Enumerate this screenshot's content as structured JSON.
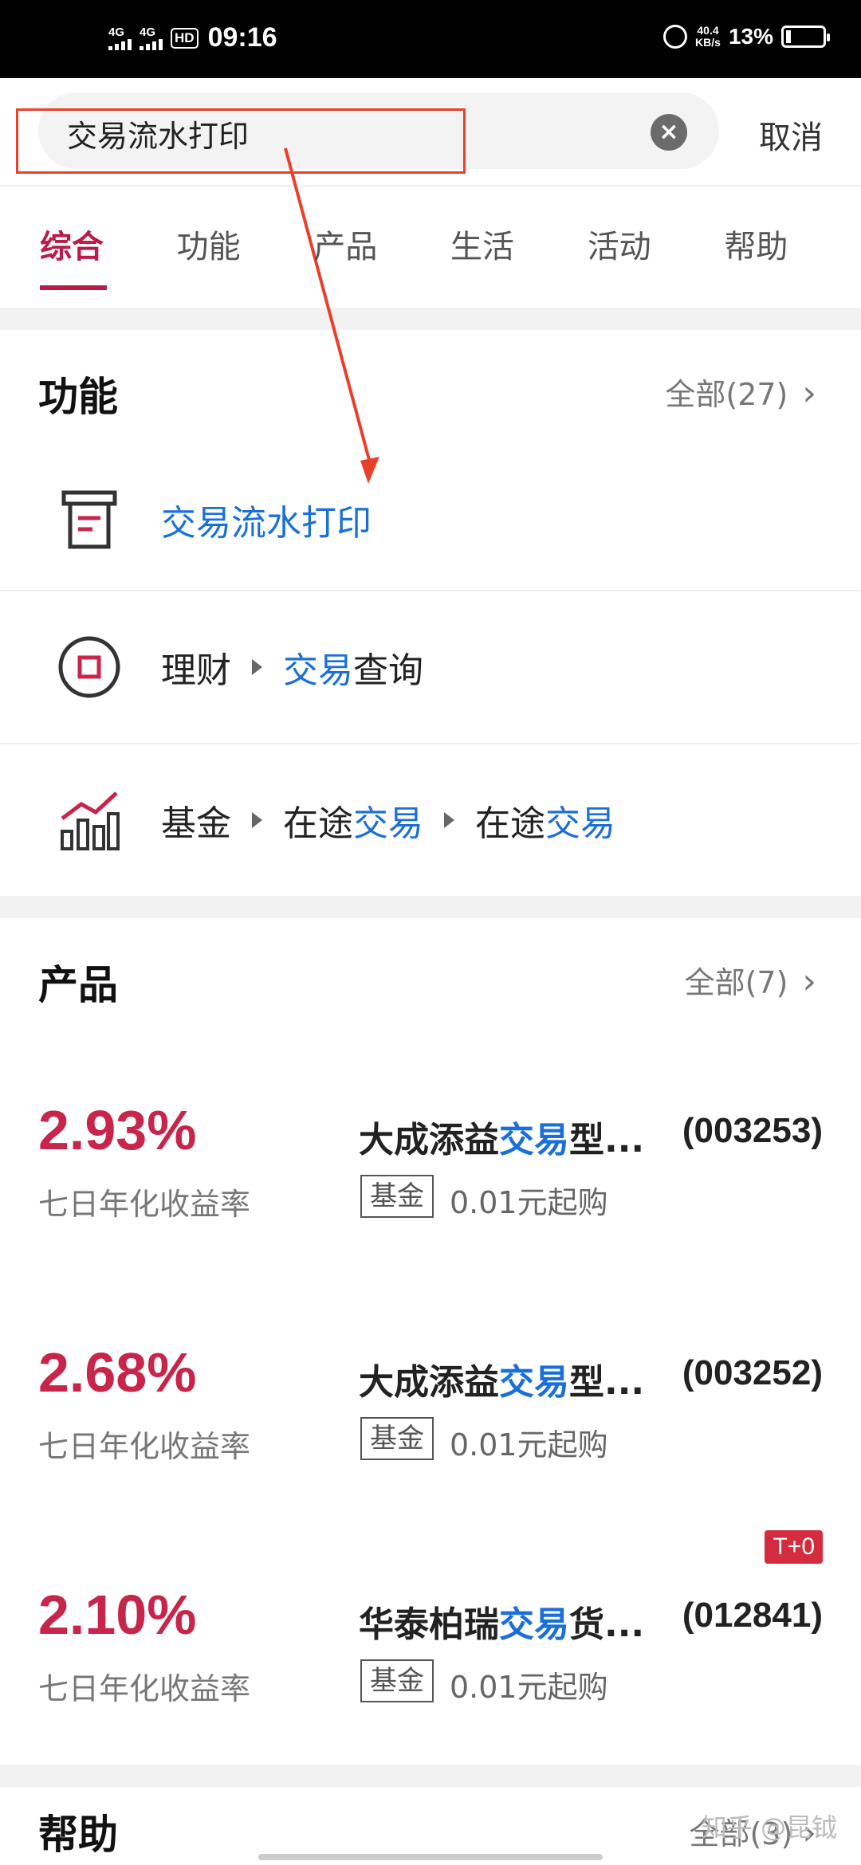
{
  "status": {
    "net1": "4G",
    "net2": "4G",
    "hd": "HD",
    "time": "09:16",
    "speed_top": "40.4",
    "speed_bottom": "KB/s",
    "battery": "13%"
  },
  "search": {
    "query": "交易流水打印",
    "cancel": "取消"
  },
  "tabs": [
    "综合",
    "功能",
    "产品",
    "生活",
    "活动",
    "帮助"
  ],
  "functions": {
    "title": "功能",
    "all": "全部(27)",
    "items": [
      {
        "icon": "printer-icon",
        "text": "交易流水打印"
      },
      {
        "icon": "wealth-icon",
        "path": [
          "理财",
          "交易查询"
        ]
      },
      {
        "icon": "fund-chart-icon",
        "path": [
          "基金",
          "在途交易",
          "在途交易"
        ]
      }
    ]
  },
  "products": {
    "title": "产品",
    "all": "全部(7)",
    "items": [
      {
        "rate": "2.93%",
        "rate_label": "七日年化收益率",
        "name_pre": "大成添益",
        "name_hl": "交易",
        "name_post": "型...",
        "code": "(003253)",
        "tag": "基金",
        "min": "0.01元起购"
      },
      {
        "rate": "2.68%",
        "rate_label": "七日年化收益率",
        "name_pre": "大成添益",
        "name_hl": "交易",
        "name_post": "型...",
        "code": "(003252)",
        "tag": "基金",
        "min": "0.01元起购"
      },
      {
        "rate": "2.10%",
        "rate_label": "七日年化收益率",
        "name_pre": "华泰柏瑞",
        "name_hl": "交易",
        "name_post": "货...",
        "code": "(012841)",
        "tag": "基金",
        "min": "0.01元起购",
        "badge": "T+0"
      }
    ]
  },
  "help": {
    "title": "帮助",
    "all": "全部(3)"
  },
  "watermark": "知乎 @昆钺",
  "colors": {
    "accent": "#b91d47",
    "link": "#1a6fd8",
    "rate": "#c8254a",
    "annotation": "#e8402a"
  }
}
